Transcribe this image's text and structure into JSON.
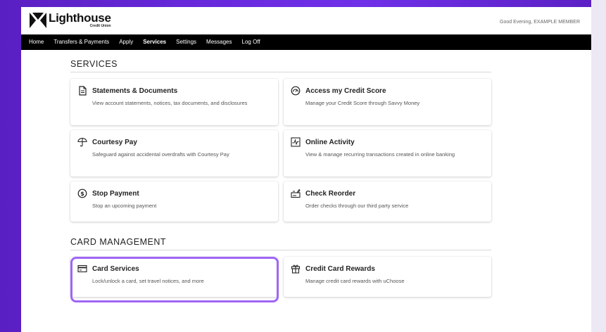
{
  "brand": {
    "name": "Lighthouse",
    "sub": "Credit Union"
  },
  "greeting": "Good Evening, EXAMPLE MEMBER",
  "nav": [
    {
      "label": "Home",
      "active": false
    },
    {
      "label": "Transfers & Payments",
      "active": false
    },
    {
      "label": "Apply",
      "active": false
    },
    {
      "label": "Services",
      "active": true
    },
    {
      "label": "Settings",
      "active": false
    },
    {
      "label": "Messages",
      "active": false
    },
    {
      "label": "Log Off",
      "active": false
    }
  ],
  "services": {
    "title": "SERVICES",
    "cards": [
      {
        "title": "Statements & Documents",
        "desc": "View account statements, notices, tax documents, and disclosures",
        "icon": "document-icon"
      },
      {
        "title": "Access my Credit Score",
        "desc": "Manage your Credit Score through Savvy Money",
        "icon": "gauge-icon"
      },
      {
        "title": "Courtesy Pay",
        "desc": "Safeguard against accidental overdrafts with Courtesy Pay",
        "icon": "umbrella-icon"
      },
      {
        "title": "Online Activity",
        "desc": "View & manage recurring transactions created in online banking",
        "icon": "activity-icon"
      },
      {
        "title": "Stop Payment",
        "desc": "Stop an upcoming payment",
        "icon": "dollar-circle-icon"
      },
      {
        "title": "Check Reorder",
        "desc": "Order checks through our third party service",
        "icon": "checkbook-icon"
      }
    ]
  },
  "card_management": {
    "title": "CARD MANAGEMENT",
    "cards": [
      {
        "title": "Card Services",
        "desc": "Lock/unlock a card, set travel notices, and more",
        "icon": "credit-card-icon",
        "highlighted": true
      },
      {
        "title": "Credit Card Rewards",
        "desc": "Manage credit card rewards with uChoose",
        "icon": "gift-icon"
      }
    ]
  },
  "colors": {
    "highlight": "#a066f5",
    "navbar": "#000000",
    "background": "#6a2be0"
  }
}
